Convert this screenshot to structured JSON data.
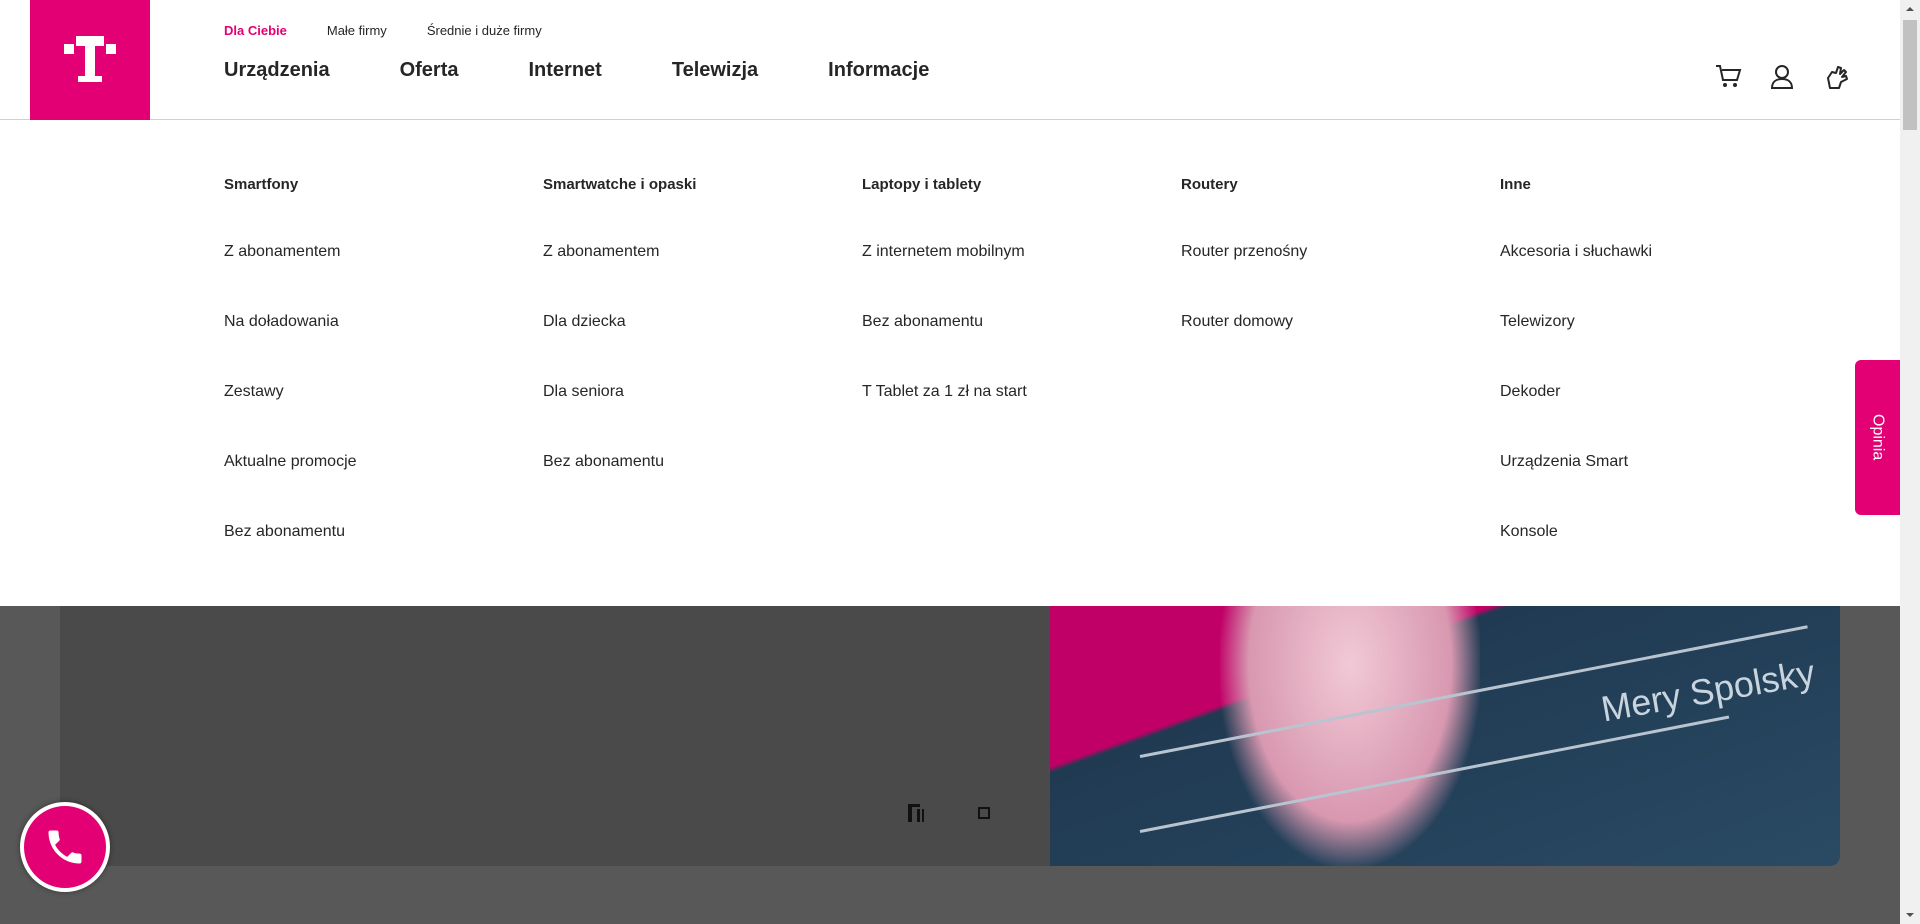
{
  "header": {
    "segments": [
      "Dla Ciebie",
      "Małe firmy",
      "Średnie i duże firmy"
    ],
    "nav": [
      "Urządzenia",
      "Oferta",
      "Internet",
      "Telewizja",
      "Informacje"
    ],
    "icons": [
      "cart-icon",
      "user-icon",
      "sign-language-icon"
    ]
  },
  "mega": {
    "columns": [
      {
        "title": "Smartfony",
        "items": [
          "Z abonamentem",
          "Na doładowania",
          "Zestawy",
          "Aktualne promocje",
          "Bez abonamentu"
        ]
      },
      {
        "title": "Smartwatche i opaski",
        "items": [
          "Z abonamentem",
          "Dla dziecka",
          "Dla seniora",
          "Bez abonamentu"
        ]
      },
      {
        "title": "Laptopy i tablety",
        "items": [
          "Z internetem mobilnym",
          "Bez abonamentu",
          "T Tablet za 1 zł na start"
        ]
      },
      {
        "title": "Routery",
        "items": [
          "Router przenośny",
          "Router domowy"
        ]
      },
      {
        "title": "Inne",
        "items": [
          "Akcesoria i słuchawki",
          "Telewizory",
          "Dekoder",
          "Urządzenia Smart",
          "Konsole"
        ]
      }
    ]
  },
  "hero": {
    "artist": "Mery Spolsky"
  },
  "feedback": {
    "label": "Opinia"
  },
  "colors": {
    "brand": "#e20074"
  }
}
